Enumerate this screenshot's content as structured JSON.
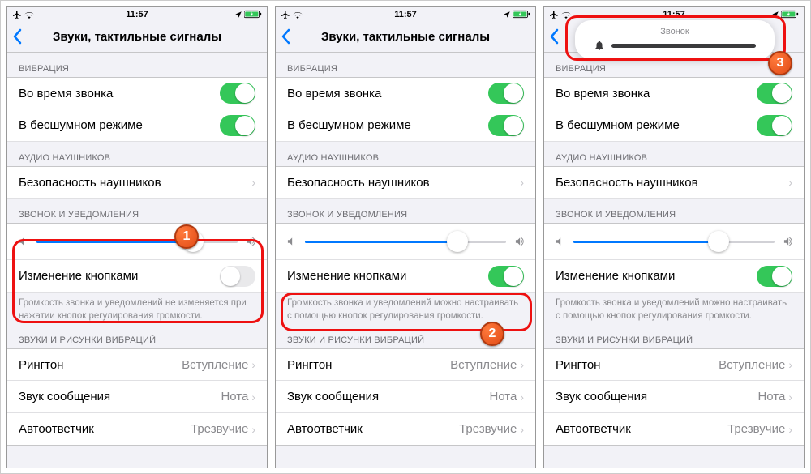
{
  "status": {
    "time": "11:57"
  },
  "nav": {
    "title": "Звуки, тактильные сигналы"
  },
  "sections": {
    "vibration": {
      "header": "ВИБРАЦИЯ",
      "row_ring": "Во время звонка",
      "row_silent": "В бесшумном режиме"
    },
    "headphones": {
      "header": "АУДИО НАУШНИКОВ",
      "row_safety": "Безопасность наушников"
    },
    "ringer": {
      "header": "ЗВОНОК И УВЕДОМЛЕНИЯ",
      "row_change": "Изменение кнопками",
      "footer_off": "Громкость звонка и уведомлений не изменяется при нажатии кнопок регулирования громкости.",
      "footer_on": "Громкость звонка и уведомлений можно настраивать с помощью кнопок регулирования громкости."
    },
    "sounds": {
      "header": "ЗВУКИ И РИСУНКИ ВИБРАЦИЙ",
      "ringtone_label": "Рингтон",
      "ringtone_value": "Вступление",
      "text_label": "Звук сообщения",
      "text_value": "Нота",
      "voicemail_label": "Автоответчик",
      "voicemail_value": "Трезвучие"
    }
  },
  "hud": {
    "title": "Звонок"
  },
  "badges": {
    "b1": "1",
    "b2": "2",
    "b3": "3"
  },
  "colors": {
    "accent": "#0078ff",
    "toggle_on": "#34c759",
    "callout": "#e11",
    "badge": "#e85b24"
  },
  "slider": {
    "p1_pct": 78,
    "p2_pct": 76,
    "p3_pct": 72
  },
  "_note_p2_footer": "Громкость звонка и уведомле\nнастраивать с помощью кно\nгромкости."
}
